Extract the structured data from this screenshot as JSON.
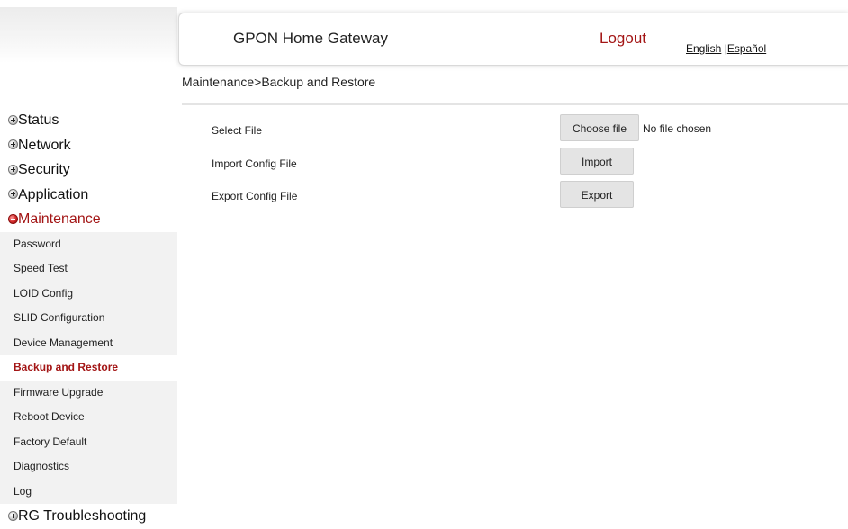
{
  "header": {
    "title": "GPON Home Gateway",
    "logout": "Logout",
    "lang_english": "English",
    "lang_separator": " |",
    "lang_spanish": "Español"
  },
  "breadcrumb": "Maintenance>Backup and Restore",
  "menu": {
    "categories_top": [
      {
        "label": "Status",
        "icon": "plus-icon"
      },
      {
        "label": "Network",
        "icon": "plus-icon"
      },
      {
        "label": "Security",
        "icon": "plus-icon"
      },
      {
        "label": "Application",
        "icon": "plus-icon"
      }
    ],
    "active_category": {
      "label": "Maintenance",
      "icon": "minus-icon"
    },
    "sub_items": [
      "Password",
      "Speed Test",
      "LOID Config",
      "SLID Configuration",
      "Device Management",
      "Backup and Restore",
      "Firmware Upgrade",
      "Reboot Device",
      "Factory Default",
      "Diagnostics",
      "Log"
    ],
    "active_sub_item": "Backup and Restore",
    "categories_bottom": [
      {
        "label": "RG Troubleshooting",
        "icon": "plus-icon"
      }
    ]
  },
  "content": {
    "select_file_label": "Select File",
    "choose_file_button": "Choose file",
    "no_file_text": "No file chosen",
    "import_label": "Import Config File",
    "import_button": "Import",
    "export_label": "Export Config File",
    "export_button": "Export"
  },
  "colors": {
    "accent": "#a31515",
    "submenu_bg": "#f2f2f2",
    "button_bg": "#e4e4e4"
  }
}
